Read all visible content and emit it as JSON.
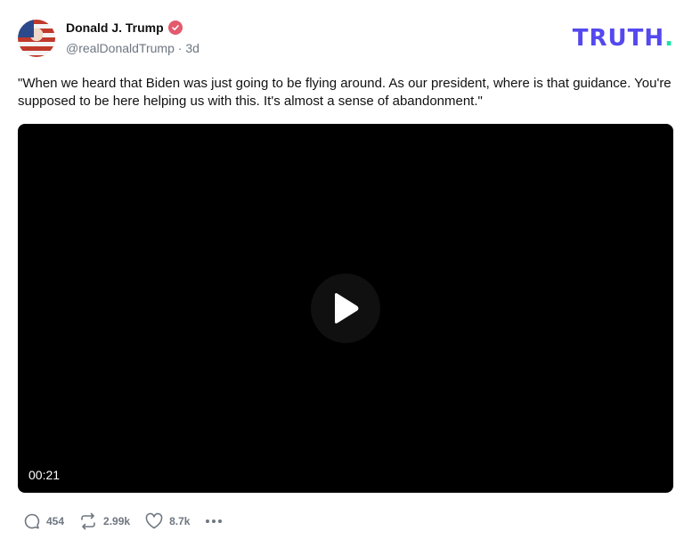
{
  "author": {
    "name": "Donald J. Trump",
    "handle": "@realDonaldTrump",
    "separator": "·",
    "time": "3d"
  },
  "brand": {
    "logo_text": "TRUTH",
    "logo_dot": ".",
    "logo_color": "#5448ee",
    "dot_color": "#17e3a6"
  },
  "post": {
    "text": "\"When we heard that Biden was just going to be flying around. As our president, where is that guidance. You're supposed to be here helping us with this. It's almost a sense of abandonment.\""
  },
  "video": {
    "duration": "00:21",
    "play_icon": "play-icon"
  },
  "actions": {
    "reply_count": "454",
    "repost_count": "2.99k",
    "like_count": "8.7k",
    "icons": [
      "reply-icon",
      "repost-icon",
      "like-icon",
      "more-icon"
    ]
  },
  "colors": {
    "verified_badge": "#e35a6d",
    "muted_text": "#6e7681"
  }
}
